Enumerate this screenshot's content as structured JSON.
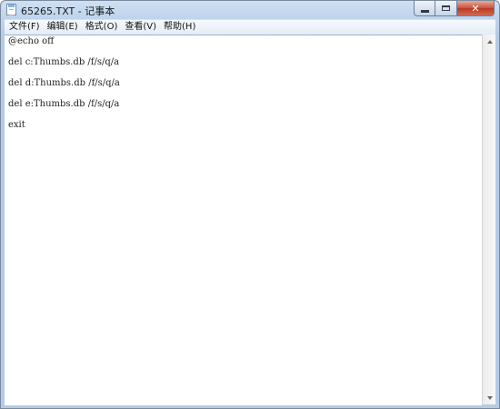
{
  "window": {
    "title": "65265.TXT - 记事本",
    "icon": "notepad-icon",
    "controls": {
      "minimize": "minimize-icon",
      "maximize": "maximize-icon",
      "close": "close-icon",
      "close_glyph": "✕"
    }
  },
  "menu": {
    "file": "文件(F)",
    "edit": "编辑(E)",
    "format": "格式(O)",
    "view": "查看(V)",
    "help": "帮助(H)"
  },
  "document": {
    "lines": [
      "@echo off",
      "del c:Thumbs.db /f/s/q/a",
      "del d:Thumbs.db /f/s/q/a",
      "del e:Thumbs.db /f/s/q/a",
      "exit"
    ]
  },
  "colors": {
    "frame": "#b4cbe6",
    "close_button": "#c9513b",
    "text": "#222222"
  }
}
